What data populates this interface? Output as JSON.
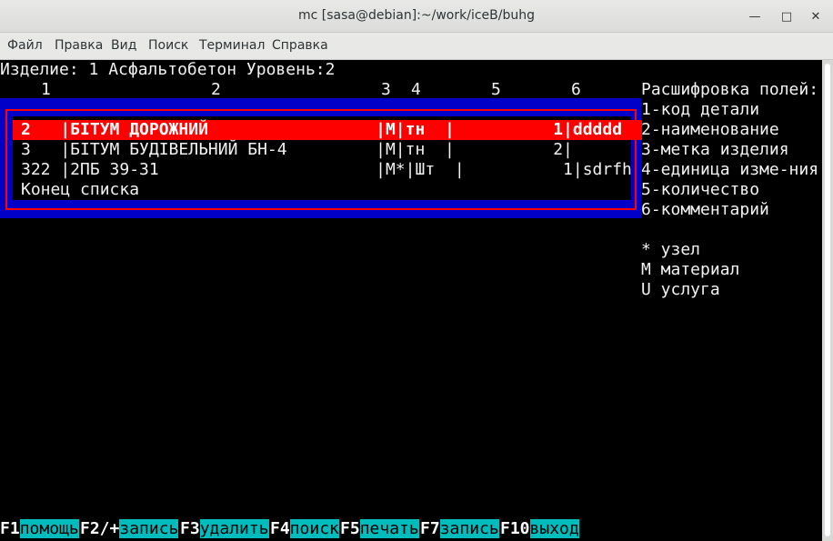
{
  "window": {
    "title": "mc [sasa@debian]:~/work/iceB/buhg"
  },
  "menu": [
    "Файл",
    "Правка",
    "Вид",
    "Поиск",
    "Терминал",
    "Справка"
  ],
  "header": {
    "line1": "Изделие: 1 Асфальтобетон Уровень:2",
    "col_numbers": [
      "1",
      "2",
      "3",
      "4",
      "5",
      "6"
    ]
  },
  "rows": [
    "2   |БІТУМ ДОРОЖНИЙ                 |М|тн  |          1|ddddd",
    "3   |БІТУМ БУДІВЕЛЬНИЙ БН-4         |М|тн  |          2|",
    "322 |2ПБ 39-31                      |М*|Шт  |          1|sdrfh"
  ],
  "end_of_list": "Конец списка",
  "legend": [
    "Расшифровка полей:",
    "1-код детали",
    "2-наименование",
    "3-метка изделия",
    "4-единица изме-ния",
    "5-количество",
    "6-комментарий",
    "",
    "* узел",
    "М материал",
    "U услуга"
  ],
  "fkeys": [
    {
      "key": "F1",
      "label": "помощь"
    },
    {
      "key": "F2/+",
      "label": "запись"
    },
    {
      "key": "F3",
      "label": "удалить"
    },
    {
      "key": "F4",
      "label": "поиск"
    },
    {
      "key": "F5",
      "label": "печать"
    },
    {
      "key": "F7",
      "label": "запись"
    },
    {
      "key": "F10",
      "label": "выход"
    }
  ],
  "colors": {
    "highlight": "#ff0000",
    "frame": "#0000c8",
    "fkey_bg": "#00bcbc"
  }
}
